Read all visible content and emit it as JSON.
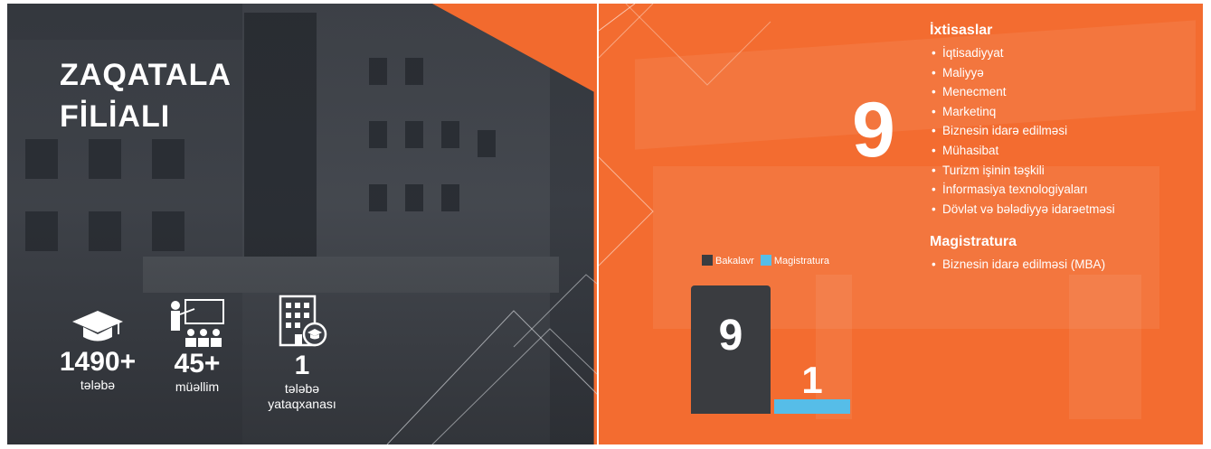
{
  "branch": {
    "title_line1": "ZAQATALA",
    "title_line2": "FİLİALI"
  },
  "stats": [
    {
      "icon": "graduation-cap-icon",
      "value": "1490+",
      "label": "tələbə"
    },
    {
      "icon": "teacher-icon",
      "value": "45+",
      "label": "müəllim"
    },
    {
      "icon": "dormitory-building-icon",
      "value": "1",
      "label_line1": "tələbə",
      "label_line2": "yataqxanası"
    }
  ],
  "specialties": {
    "count": "9",
    "heading": "İxtisaslar",
    "items": [
      "İqtisadiyyat",
      "Maliyyə",
      "Menecment",
      "Marketinq",
      "Biznesin idarə edilməsi",
      "Mühasibat",
      "Turizm işinin təşkili",
      "İnformasiya texnologiyaları",
      "Dövlət və bələdiyyə idarəetməsi"
    ]
  },
  "magistratura": {
    "heading": "Magistratura",
    "items": [
      "Biznesin idarə edilməsi (MBA)"
    ]
  },
  "chart_data": {
    "type": "bar",
    "categories": [
      "Bakalavr",
      "Magistratura"
    ],
    "values": [
      9,
      1
    ],
    "colors": [
      "#3a3c40",
      "#56bde8"
    ],
    "legend": [
      "Bakalavr",
      "Magistratura"
    ],
    "ylim": [
      0,
      9
    ]
  },
  "colors": {
    "orange": "#f36c30",
    "dark": "#3d4148",
    "bar_dark": "#3a3c40",
    "bar_blue": "#56bde8"
  }
}
